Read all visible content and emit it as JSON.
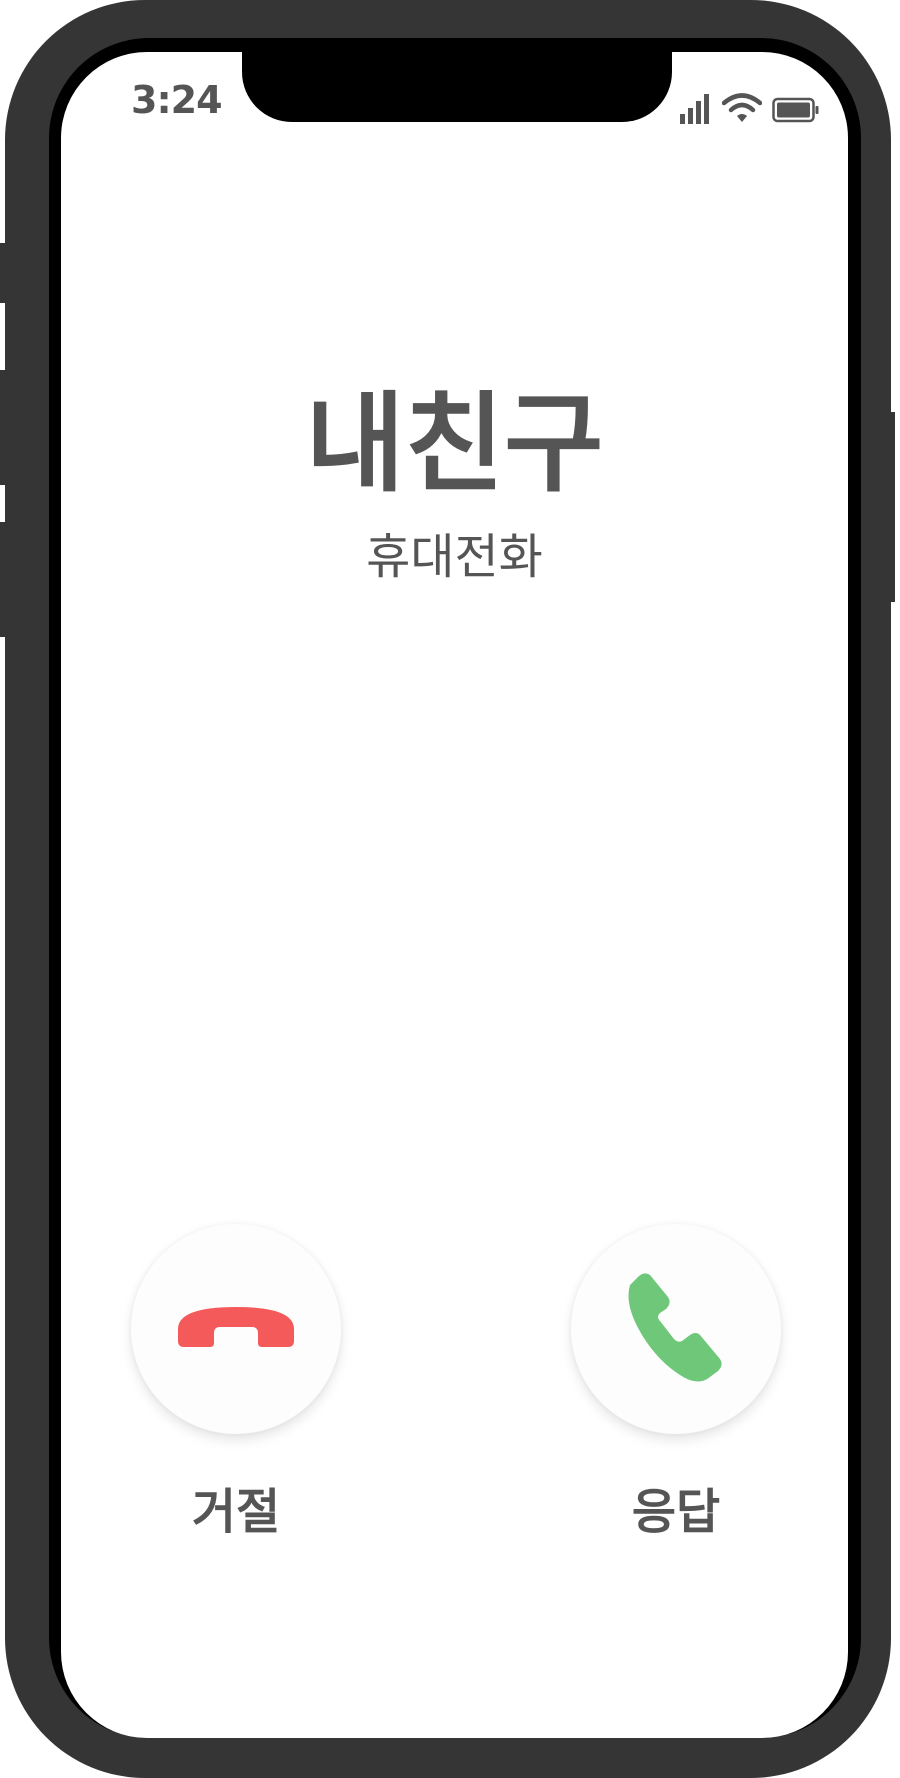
{
  "status_bar": {
    "time": "3:24",
    "icons": [
      "cellular-signal-icon",
      "wifi-icon",
      "battery-icon"
    ]
  },
  "caller": {
    "name": "내친구",
    "label": "휴대전화"
  },
  "actions": {
    "decline": {
      "label": "거절",
      "icon": "hang-up-phone-icon",
      "color": "#f45a5a"
    },
    "answer": {
      "label": "응답",
      "icon": "phone-icon",
      "color": "#6fc77a"
    }
  },
  "colors": {
    "frame": "#353535",
    "text": "#555555",
    "screen": "#ffffff"
  }
}
